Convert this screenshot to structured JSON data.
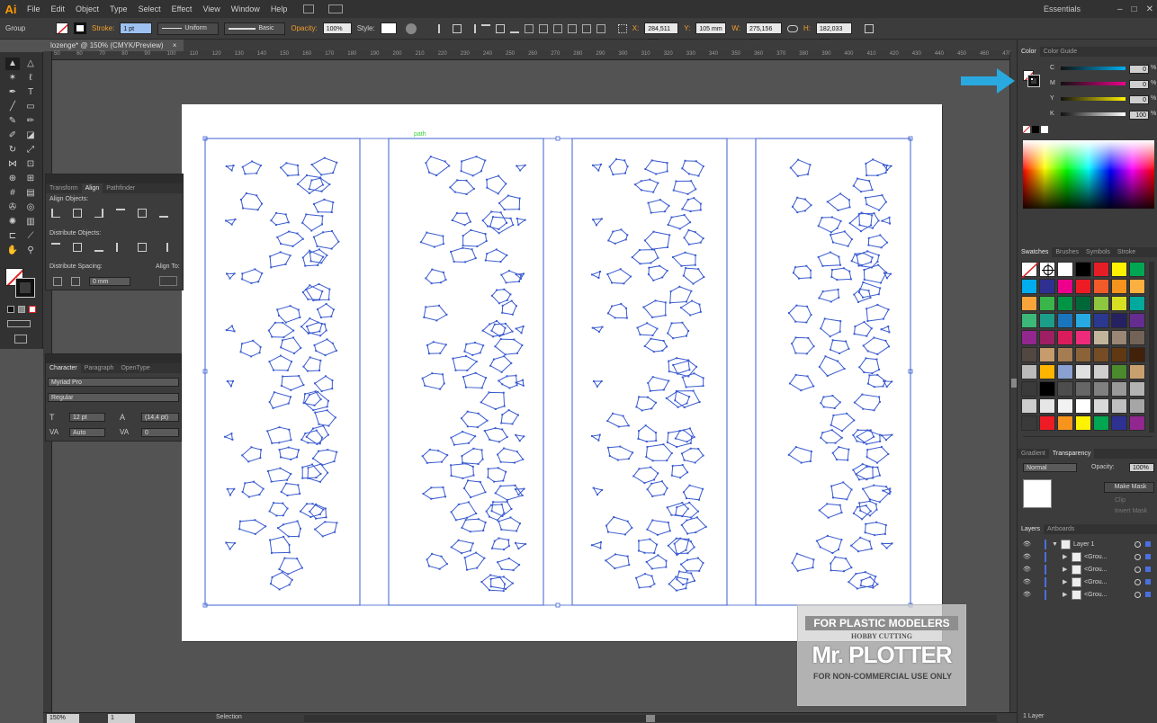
{
  "app": {
    "logo": "Ai",
    "workspace": "Essentials"
  },
  "menu": [
    "File",
    "Edit",
    "Object",
    "Type",
    "Select",
    "Effect",
    "View",
    "Window",
    "Help"
  ],
  "window_controls": [
    "–",
    "□",
    "✕"
  ],
  "control_bar": {
    "selection_label": "Group",
    "stroke_label": "Stroke:",
    "stroke_value": "1 pt",
    "profile": "Uniform",
    "brush": "Basic",
    "opacity_label": "Opacity:",
    "opacity_value": "100%",
    "style_label": "Style:",
    "x_label": "X:",
    "x_value": "284,511 mm",
    "y_label": "Y:",
    "y_value": "105 mm",
    "w_label": "W:",
    "w_value": "275,156 mm",
    "h_label": "H:",
    "h_value": "182,033 mm"
  },
  "document_tab": "lozenge* @ 150% (CMYK/Preview)",
  "ruler_ticks": [
    "50",
    "60",
    "70",
    "80",
    "90",
    "100",
    "110",
    "120",
    "130",
    "140",
    "150",
    "160",
    "170",
    "180",
    "190",
    "200",
    "210",
    "220",
    "230",
    "240",
    "250",
    "260",
    "270",
    "280",
    "290",
    "300",
    "310",
    "320",
    "330",
    "340",
    "350",
    "360",
    "370",
    "380",
    "390",
    "400",
    "410",
    "420",
    "430",
    "440",
    "450",
    "460",
    "470"
  ],
  "canvas_hover_label": "path",
  "align_panel": {
    "tabs": [
      "Transform",
      "Align",
      "Pathfinder"
    ],
    "align_objects": "Align Objects:",
    "distribute_objects": "Distribute Objects:",
    "distribute_spacing": "Distribute Spacing:",
    "align_to": "Align To:",
    "spacing_value": "0 mm"
  },
  "character_panel": {
    "tabs": [
      "Character",
      "Paragraph",
      "OpenType"
    ],
    "font_family": "Myriad Pro",
    "font_style": "Regular",
    "font_size": "12 pt",
    "leading": "(14,4 pt)",
    "kerning": "Auto",
    "tracking": "0"
  },
  "color_panel": {
    "tabs": [
      "Color",
      "Color Guide"
    ],
    "channels": [
      {
        "name": "C",
        "value": "0",
        "unit": "%"
      },
      {
        "name": "M",
        "value": "0",
        "unit": "%"
      },
      {
        "name": "Y",
        "value": "0",
        "unit": "%"
      },
      {
        "name": "K",
        "value": "100",
        "unit": "%"
      }
    ]
  },
  "swatches_panel": {
    "tabs": [
      "Swatches",
      "Brushes",
      "Symbols",
      "Stroke"
    ],
    "rows": [
      [
        "none",
        "register",
        "#ffffff",
        "#000000",
        "#e51e25",
        "#fff200",
        "#00a651"
      ],
      [
        "#00aeef",
        "#2e3192",
        "#ec008c",
        "#ed1c24",
        "#f15a29",
        "#f7941d",
        "#fbb040"
      ],
      [
        "#f9a33b",
        "#39b54a",
        "#009444",
        "#006838",
        "#8dc63f",
        "#d7df23",
        "#00a99d"
      ],
      [
        "#3cb878",
        "#1c9d8a",
        "#1b75bc",
        "#27aae1",
        "#2b388f",
        "#262262",
        "#662d91"
      ],
      [
        "#92278f",
        "#9e1f63",
        "#da1c5c",
        "#ee2a7b",
        "#c2b59b",
        "#998675",
        "#736357"
      ],
      [
        "#534741",
        "#c69c6d",
        "#a67c52",
        "#8c6239",
        "#754c24",
        "#603913",
        "#42210b"
      ],
      [
        "#bbbbbb",
        "#ffb400",
        "#8aa0d0",
        "#e0e0e0",
        "#cfcfcf",
        "#4c8a2e",
        "#c8a070"
      ],
      [
        "#3a3a3a",
        "#000000",
        "#4d4d4d",
        "#666666",
        "#808080",
        "#999999",
        "#b3b3b3"
      ],
      [
        "#cccccc",
        "#e6e6e6",
        "#f2f2f2",
        "#ffffff",
        "#d9d9d9",
        "#bfbfbf",
        "#a6a6a6"
      ],
      [
        "#3a3a3a",
        "#ed1c24",
        "#f7941d",
        "#fff200",
        "#00a651",
        "#2e3192",
        "#92278f"
      ]
    ]
  },
  "transparency_panel": {
    "tabs": [
      "Gradient",
      "Transparency"
    ],
    "blend_mode": "Normal",
    "opacity_label": "Opacity:",
    "opacity_value": "100%",
    "make_mask": "Make Mask",
    "clip": "Clip",
    "invert_mask": "Invert Mask"
  },
  "layers_panel": {
    "tabs": [
      "Layers",
      "Artboards"
    ],
    "rows": [
      "Layer 1",
      "<Grou...",
      "<Grou...",
      "<Grou...",
      "<Grou..."
    ],
    "footer": "1 Layer"
  },
  "status_bar": {
    "zoom": "150%",
    "artboard": "1",
    "tool": "Selection"
  },
  "watermark": {
    "line1": "FOR PLASTIC MODELERS",
    "line2": "HOBBY CUTTING",
    "line3": "Mr. PLOTTER",
    "line4": "FOR NON-COMMERCIAL USE ONLY"
  },
  "colors": {
    "accent": "#f29d2b",
    "selection": "#3b5fd1",
    "arrow": "#29a9e0"
  }
}
